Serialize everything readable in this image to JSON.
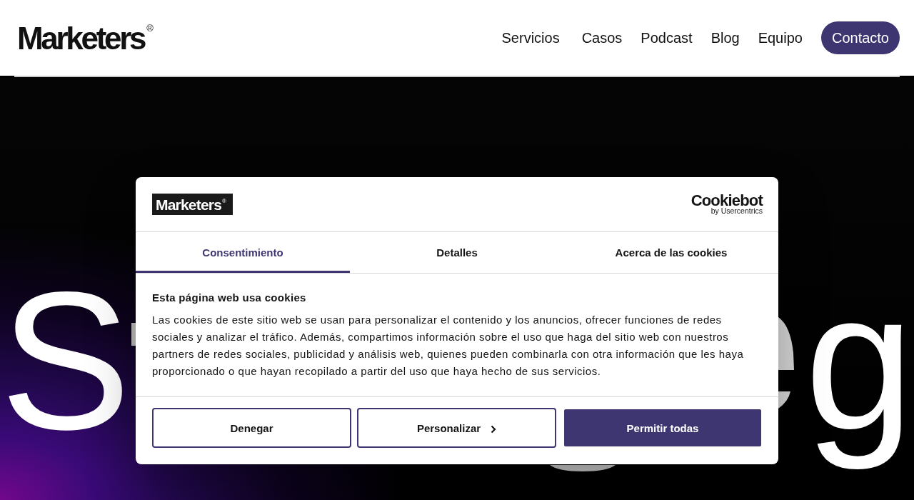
{
  "header": {
    "logo": "Marketers$^{®}$",
    "nav": [
      {
        "label": "Servicios"
      },
      {
        "label": "Casos"
      },
      {
        "label": "Podcast"
      },
      {
        "label": "Blog"
      },
      {
        "label": "Equipo"
      }
    ],
    "cta": "Contacto"
  },
  "hero": {
    "heading_start": "S",
    "heading_end": "g"
  },
  "cookie_dialog": {
    "brand_logo": "Marketers$^{®}$",
    "provider_logo": "Cookiebot",
    "provider_byline": "by Usercentrics",
    "tabs": [
      {
        "label": "Consentimiento",
        "selected": true
      },
      {
        "label": "Detalles",
        "selected": false
      },
      {
        "label": "Acerca de las cookies",
        "selected": false
      }
    ],
    "title": "Esta página web usa cookies",
    "text": "Las cookies de este sitio web se usan para personalizar el contenido y los anuncios, ofrecer funciones de redes sociales y analizar el tráfico. Además, compartimos información sobre el uso que haga del sitio web con nuestros partners de redes sociales, publicidad y análisis web, quienes pueden combinarla con otra información que les haya proporcionado o que hayan recopilado a partir del uso que haya hecho de sus servicios.",
    "buttons": [
      {
        "label": "Denegar",
        "kind": "outline"
      },
      {
        "label": "Personalizar",
        "kind": "expand"
      },
      {
        "label": "Permitir todas",
        "kind": "primary"
      }
    ]
  }
}
